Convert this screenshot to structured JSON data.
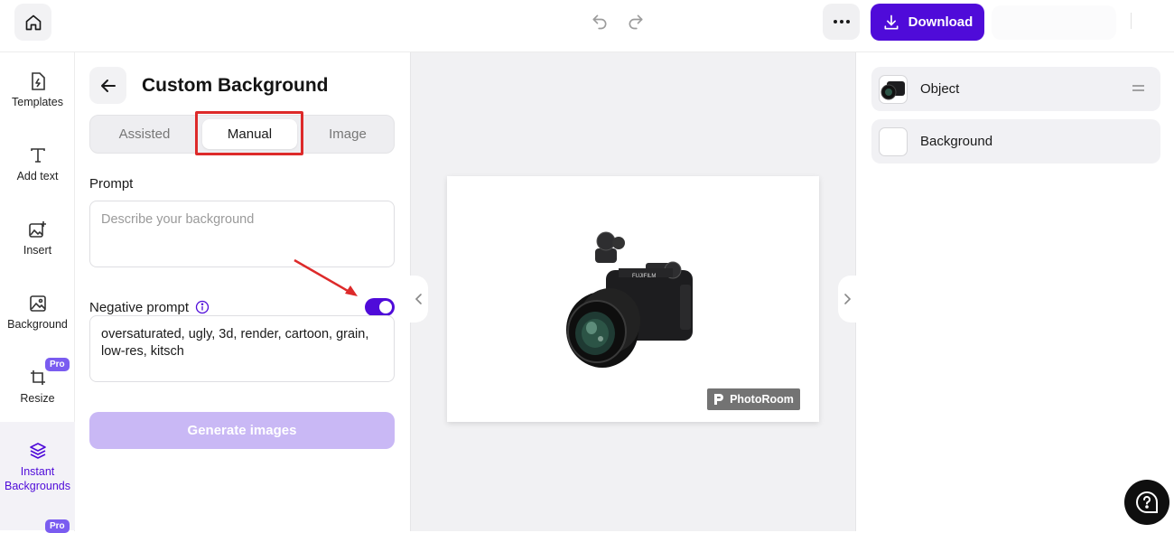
{
  "header": {
    "download_label": "Download"
  },
  "rail": {
    "items": [
      {
        "label": "Templates"
      },
      {
        "label": "Add text"
      },
      {
        "label": "Insert"
      },
      {
        "label": "Background"
      },
      {
        "label": "Resize",
        "badge": "Pro"
      },
      {
        "label": "Instant Backgrounds",
        "line1": "Instant",
        "line2": "Backgrounds"
      },
      {
        "badge": "Pro"
      }
    ]
  },
  "panel": {
    "title": "Custom Background",
    "tabs": [
      {
        "label": "Assisted"
      },
      {
        "label": "Manual",
        "selected": true
      },
      {
        "label": "Image"
      }
    ],
    "prompt_label": "Prompt",
    "prompt_placeholder": "Describe your background",
    "negative_prompt_label": "Negative prompt",
    "negative_prompt_enabled": true,
    "negative_prompt_value": "oversaturated, ugly, 3d, render, cartoon, grain, low-res, kitsch",
    "generate_label": "Generate images"
  },
  "canvas": {
    "watermark_text": "PhotoRoom"
  },
  "layers": {
    "items": [
      {
        "label": "Object"
      },
      {
        "label": "Background"
      }
    ]
  },
  "colors": {
    "accent": "#4f0bd9",
    "generate_disabled": "#c9b8f5",
    "annotation_red": "#dd2a2a"
  }
}
